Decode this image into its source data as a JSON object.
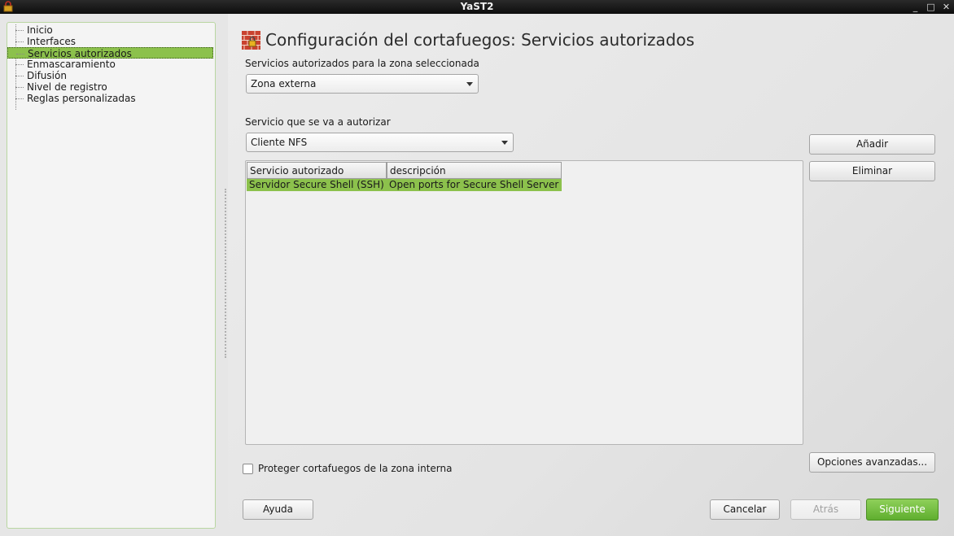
{
  "window": {
    "title": "YaST2",
    "controls": [
      "minimize-icon",
      "maximize-icon",
      "close-icon"
    ]
  },
  "sidebar": {
    "items": [
      {
        "label": "Inicio",
        "selected": false
      },
      {
        "label": "Interfaces",
        "selected": false
      },
      {
        "label": "Servicios autorizados",
        "selected": true
      },
      {
        "label": "Enmascaramiento",
        "selected": false
      },
      {
        "label": "Difusión",
        "selected": false
      },
      {
        "label": "Nivel de registro",
        "selected": false
      },
      {
        "label": "Reglas personalizadas",
        "selected": false
      }
    ]
  },
  "main": {
    "title": "Configuración del cortafuegos: Servicios autorizados",
    "zone_label": "Servicios autorizados para la zona seleccionada",
    "zone_value": "Zona externa",
    "service_label": "Servicio que se va a autorizar",
    "service_value": "Cliente NFS",
    "add_button": "Añadir",
    "remove_button": "Eliminar",
    "table": {
      "columns": [
        "Servicio autorizado",
        "descripción"
      ],
      "rows": [
        [
          "Servidor Secure Shell (SSH)",
          "Open ports for Secure Shell Server"
        ]
      ]
    },
    "advanced_button": "Opciones avanzadas...",
    "protect_checkbox": {
      "label": "Proteger cortafuegos de la zona interna",
      "checked": false
    }
  },
  "footer": {
    "help": "Ayuda",
    "cancel": "Cancelar",
    "back": "Atrás",
    "next": "Siguiente"
  },
  "colors": {
    "selection": "#8cc14c",
    "next_button": "#6dbb3c",
    "titlebar": "#1a1a1a"
  }
}
